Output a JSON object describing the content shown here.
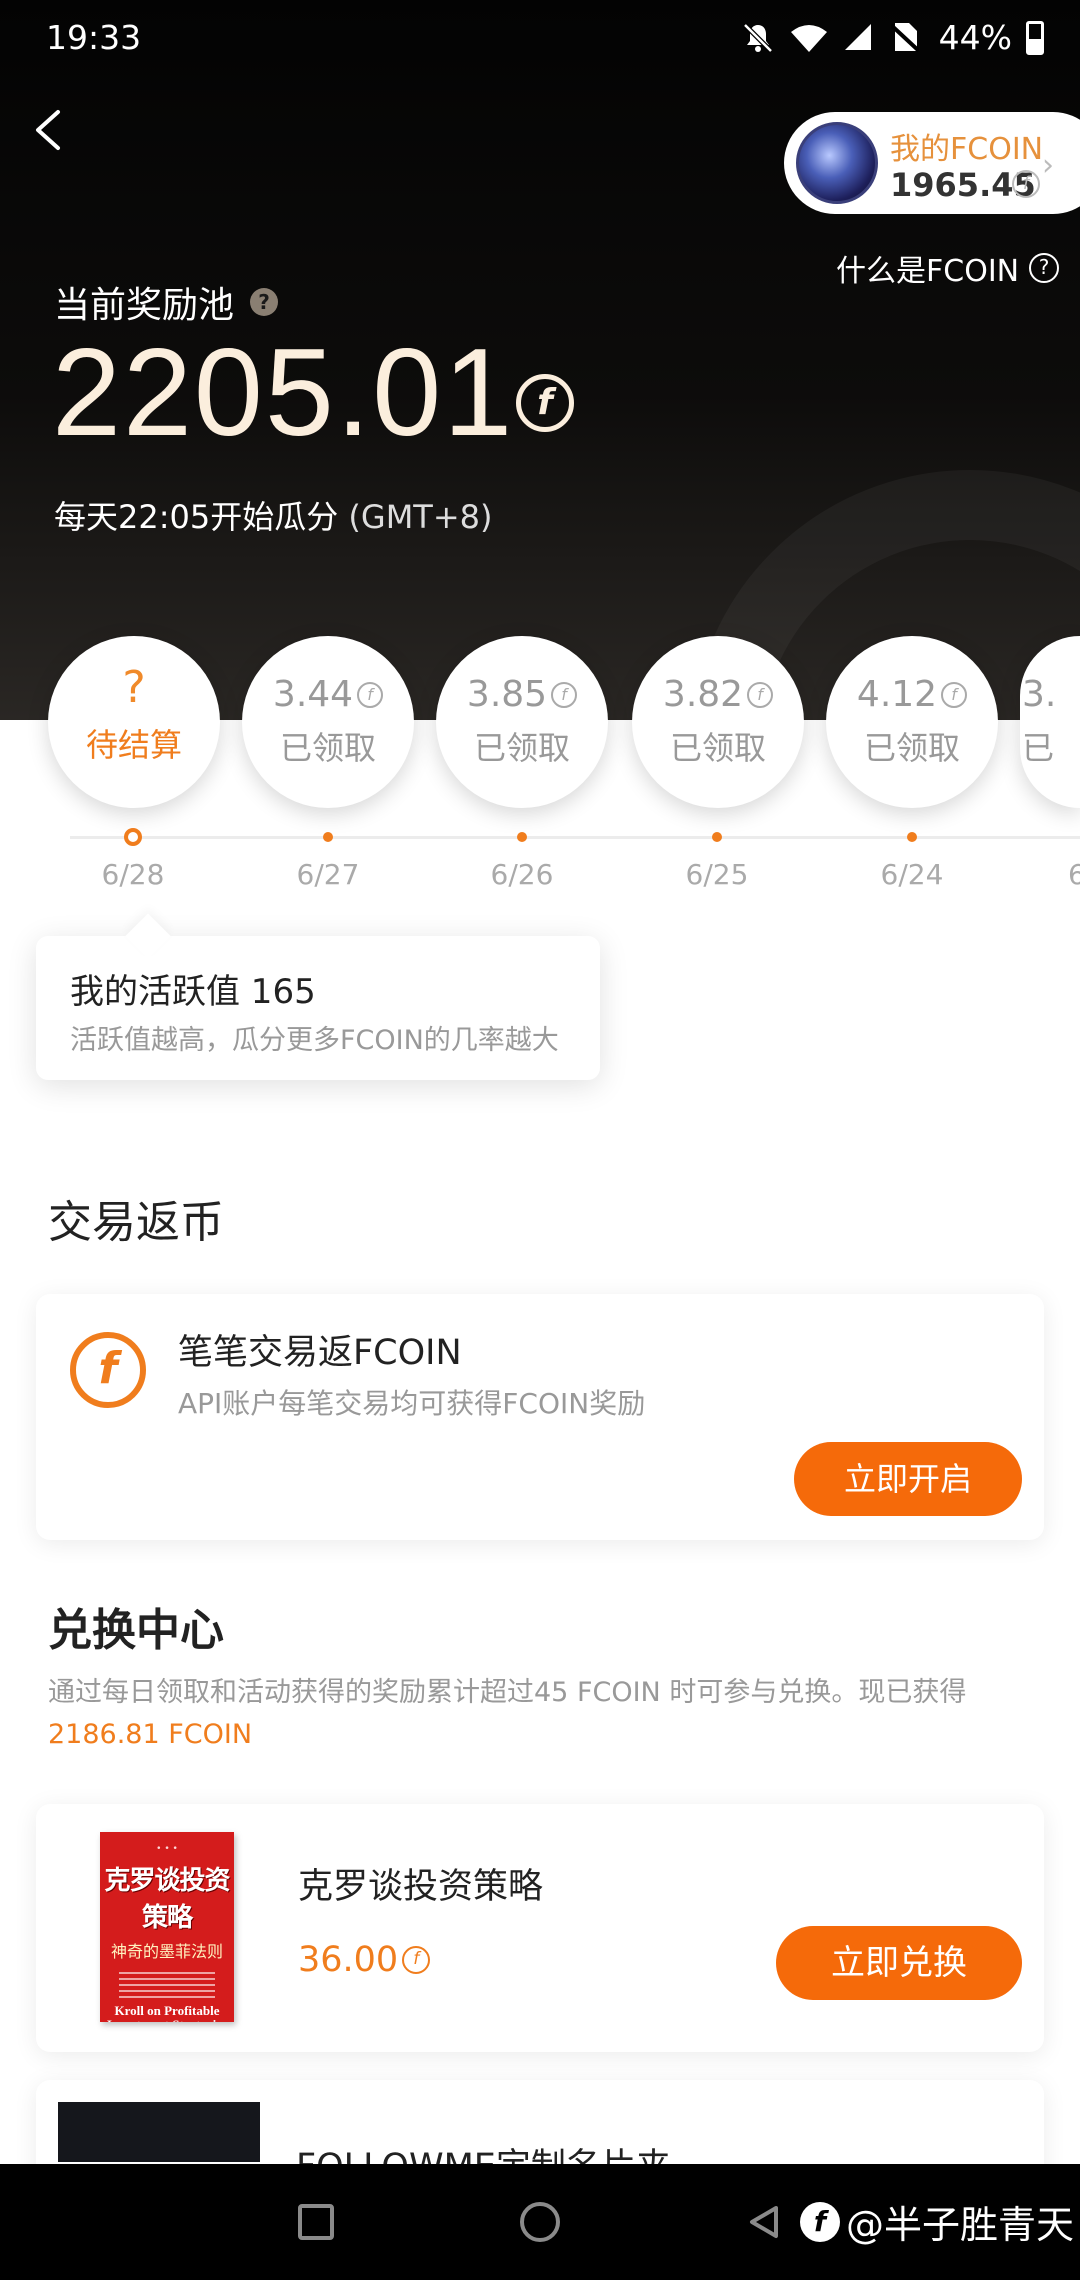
{
  "status_bar": {
    "time": "19:33",
    "battery": "44%"
  },
  "header": {
    "my_fcoin_label": "我的FCOIN",
    "my_fcoin_amount": "1965.45",
    "what_is_fcoin": "什么是FCOIN",
    "pool_label": "当前奖励池",
    "pool_amount": "2205.01",
    "split_time": "每天22:05开始瓜分",
    "split_tz": "(GMT+8)"
  },
  "days": [
    {
      "amount": "",
      "status": "待结算",
      "date": "6/28",
      "pending": true
    },
    {
      "amount": "3.44",
      "status": "已领取",
      "date": "6/27",
      "pending": false
    },
    {
      "amount": "3.85",
      "status": "已领取",
      "date": "6/26",
      "pending": false
    },
    {
      "amount": "3.82",
      "status": "已领取",
      "date": "6/25",
      "pending": false
    },
    {
      "amount": "4.12",
      "status": "已领取",
      "date": "6/24",
      "pending": false
    },
    {
      "amount": "3.",
      "status": "已",
      "date": "6",
      "pending": false
    }
  ],
  "tooltip": {
    "activity": "我的活跃值 165",
    "hint": "活跃值越高，瓜分更多FCOIN的几率越大"
  },
  "trade_rebate": {
    "section_title": "交易返币",
    "title": "笔笔交易返FCOIN",
    "subtitle": "API账户每笔交易均可获得FCOIN奖励",
    "button": "立即开启"
  },
  "exchange": {
    "section_title": "兑换中心",
    "description": "通过每日领取和活动获得的奖励累计超过45 FCOIN 时可参与兑换。现已获得",
    "earned": "2186.81 FCOIN",
    "products": [
      {
        "title": "克罗谈投资策略",
        "price": "36.00",
        "button": "立即兑换",
        "cover_title": "克罗谈投资策略",
        "cover_subtitle": "神奇的墨菲法则",
        "cover_en": "Kroll on Profitable Investment Strategies"
      },
      {
        "title": "FOLLOWME定制名片夹"
      }
    ]
  },
  "watermark": "@半子胜青天",
  "colors": {
    "accent": "#f56a0a",
    "accent_text": "#f07d1d",
    "pool_text": "#fbeedd"
  }
}
